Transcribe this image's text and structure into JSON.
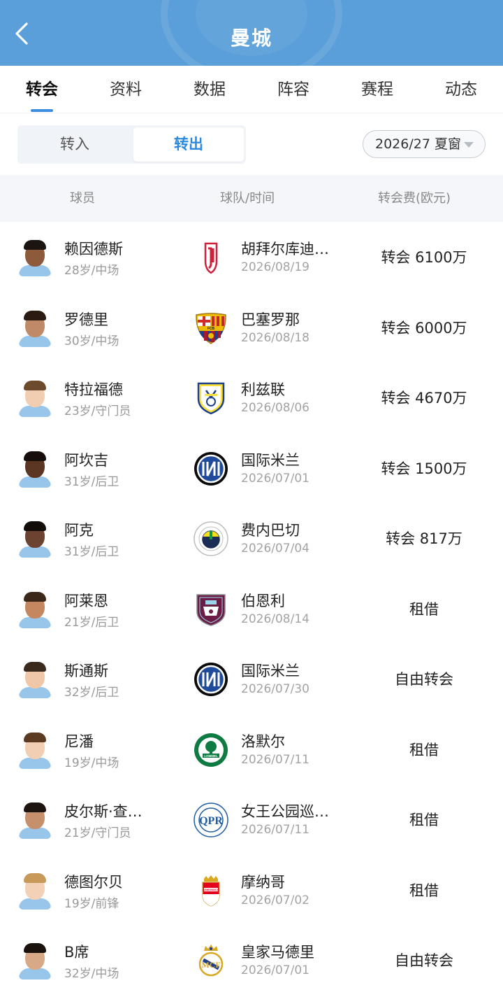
{
  "header": {
    "title": "曼城"
  },
  "tabs": [
    {
      "label": "转会"
    },
    {
      "label": "资料"
    },
    {
      "label": "数据"
    },
    {
      "label": "阵容"
    },
    {
      "label": "赛程"
    },
    {
      "label": "动态"
    }
  ],
  "segmented": {
    "in_label": "转入",
    "out_label": "转出",
    "selected": "转出"
  },
  "window_select": {
    "value": "2026/27 夏窗"
  },
  "columns": {
    "player": "球员",
    "team_time": "球队/时间",
    "fee": "转会费(欧元)"
  },
  "transfers": [
    {
      "name": "赖因德斯",
      "info": "28岁/中场",
      "team": "胡拜尔库迪…",
      "date": "2026/08/19",
      "fee": "转会 6100万",
      "team_logo": "hubaer-crest-icon"
    },
    {
      "name": "罗德里",
      "info": "30岁/中场",
      "team": "巴塞罗那",
      "date": "2026/08/18",
      "fee": "转会 6000万",
      "team_logo": "barcelona-crest-icon"
    },
    {
      "name": "特拉福德",
      "info": "23岁/守门员",
      "team": "利兹联",
      "date": "2026/08/06",
      "fee": "转会 4670万",
      "team_logo": "leeds-crest-icon"
    },
    {
      "name": "阿坎吉",
      "info": "31岁/后卫",
      "team": "国际米兰",
      "date": "2026/07/01",
      "fee": "转会 1500万",
      "team_logo": "inter-crest-icon"
    },
    {
      "name": "阿克",
      "info": "31岁/后卫",
      "team": "费内巴切",
      "date": "2026/07/04",
      "fee": "转会 817万",
      "team_logo": "fenerbahce-crest-icon"
    },
    {
      "name": "阿莱恩",
      "info": "21岁/后卫",
      "team": "伯恩利",
      "date": "2026/08/14",
      "fee": "租借",
      "team_logo": "burnley-crest-icon"
    },
    {
      "name": "斯通斯",
      "info": "32岁/后卫",
      "team": "国际米兰",
      "date": "2026/07/30",
      "fee": "自由转会",
      "team_logo": "inter-crest-icon"
    },
    {
      "name": "尼潘",
      "info": "19岁/中场",
      "team": "洛默尔",
      "date": "2026/07/11",
      "fee": "租借",
      "team_logo": "lommel-crest-icon"
    },
    {
      "name": "皮尔斯·查…",
      "info": "21岁/守门员",
      "team": "女王公园巡…",
      "date": "2026/07/11",
      "fee": "租借",
      "team_logo": "qpr-crest-icon"
    },
    {
      "name": "德图尔贝",
      "info": "19岁/前锋",
      "team": "摩纳哥",
      "date": "2026/07/02",
      "fee": "租借",
      "team_logo": "monaco-crest-icon"
    },
    {
      "name": "B席",
      "info": "32岁/中场",
      "team": "皇家马德里",
      "date": "2026/07/01",
      "fee": "自由转会",
      "team_logo": "real-madrid-crest-icon"
    }
  ],
  "colors": {
    "header": "#5a9fd9",
    "accent": "#2b8ae0"
  }
}
